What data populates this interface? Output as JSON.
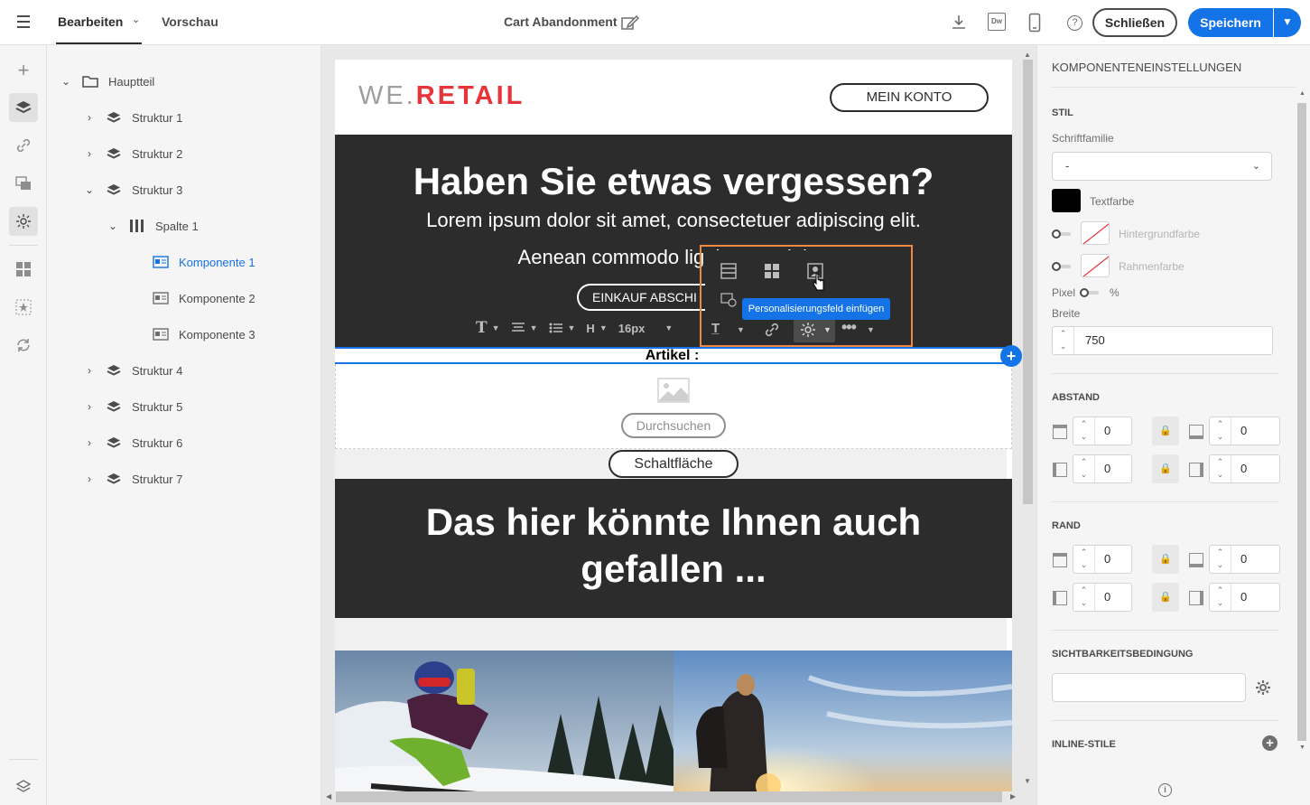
{
  "topbar": {
    "tab_edit": "Bearbeiten",
    "tab_preview": "Vorschau",
    "doc_title": "Cart Abandonment",
    "close_label": "Schließen",
    "save_label": "Speichern",
    "dw_label": "Dw"
  },
  "tree": {
    "root": "Hauptteil",
    "structures": [
      "Struktur 1",
      "Struktur 2",
      "Struktur 3",
      "Struktur 4",
      "Struktur 5",
      "Struktur 6",
      "Struktur 7"
    ],
    "column": "Spalte 1",
    "components": [
      "Komponente 1",
      "Komponente 2",
      "Komponente 3"
    ]
  },
  "email": {
    "logo_we": "WE.",
    "logo_retail": "RETAIL",
    "account_button": "MEIN KONTO",
    "hero_title": "Haben Sie etwas vergessen?",
    "hero_line1": "Lorem ipsum dolor sit amet, consectetuer adipiscing elit.",
    "hero_line2": "Aenean commodo ligula eget dolor.",
    "cta_button": "EINKAUF ABSCHI",
    "font_size": "16px",
    "article_label": "Artikel :",
    "browse_button": "Durchsuchen",
    "generic_button": "Schaltfläche",
    "section2_title": "Das hier könnte Ihnen auch gefallen ..."
  },
  "tooltip": "Personalisierungsfeld einfügen",
  "props": {
    "header": "KOMPONENTENEINSTELLUNGEN",
    "style_section": "STIL",
    "font_family_label": "Schriftfamilie",
    "font_family_value": "-",
    "text_color_label": "Textfarbe",
    "bg_color_label": "Hintergrundfarbe",
    "border_color_label": "Rahmenfarbe",
    "unit_px": "Pixel",
    "unit_pct": "%",
    "width_label": "Breite",
    "width_value": "750",
    "spacing_section": "ABSTAND",
    "spacing_values": [
      "0",
      "0",
      "0",
      "0"
    ],
    "border_section": "RAND",
    "border_values": [
      "0",
      "0",
      "0",
      "0"
    ],
    "visibility_section": "SICHTBARKEITSBEDINGUNG",
    "inline_styles_section": "INLINE-STILE"
  },
  "colors": {
    "accent": "#1473e6",
    "brand_red": "#e6343a",
    "hero_bg": "#2c2c2c",
    "highlight": "#f0883e",
    "text_color_swatch": "#000000"
  }
}
